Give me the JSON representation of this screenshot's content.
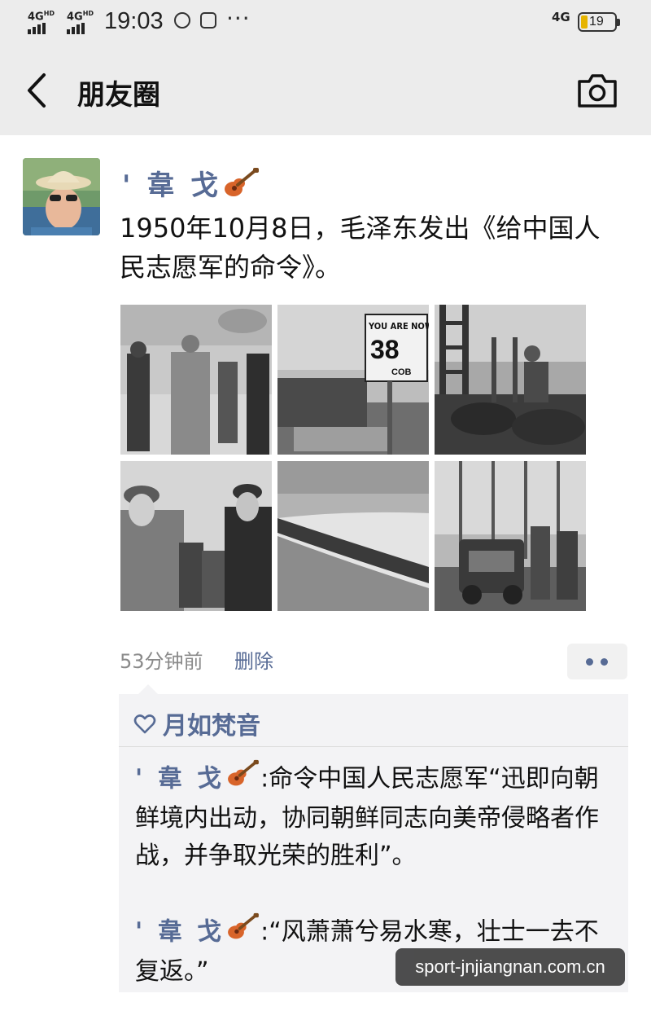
{
  "status_bar": {
    "signal_1": "4G",
    "signal_1_sup": "HD",
    "signal_2": "4G",
    "signal_2_sup": "HD",
    "time": "19:03",
    "more": "···",
    "network": "4G",
    "battery_level": "19"
  },
  "nav": {
    "title": "朋友圈"
  },
  "post": {
    "author": "' 韋 戈",
    "text": "1950年10月8日，毛泽东发出《给中国人民志愿军的命令》。",
    "photo_captions": [
      "YOU ARE NOW",
      "38",
      "COB"
    ],
    "time_ago": "53分钟前",
    "delete_label": "删除"
  },
  "likes": {
    "names": "月如梵音"
  },
  "comments": [
    {
      "author": "' 韋 戈",
      "separator": ":",
      "text": "命令中国人民志愿军“迅即向朝鲜境内出动，协同朝鲜同志向美帝侵略者作战，并争取光荣的胜利”。"
    },
    {
      "author": "' 韋 戈",
      "separator": ":",
      "text": "“风萧萧兮易水寒，壮士一去不复返。”"
    }
  ],
  "watermark": "sport-jnjiangnan.com.cn",
  "colors": {
    "link_blue": "#576b95",
    "top_bar_bg": "#ececec",
    "comment_bg": "#f3f3f5",
    "battery_yellow": "#e6b400"
  },
  "icons": {
    "back": "chevron-left-icon",
    "camera": "camera-icon",
    "heart": "heart-outline-icon",
    "guitar": "guitar-emoji-icon"
  }
}
